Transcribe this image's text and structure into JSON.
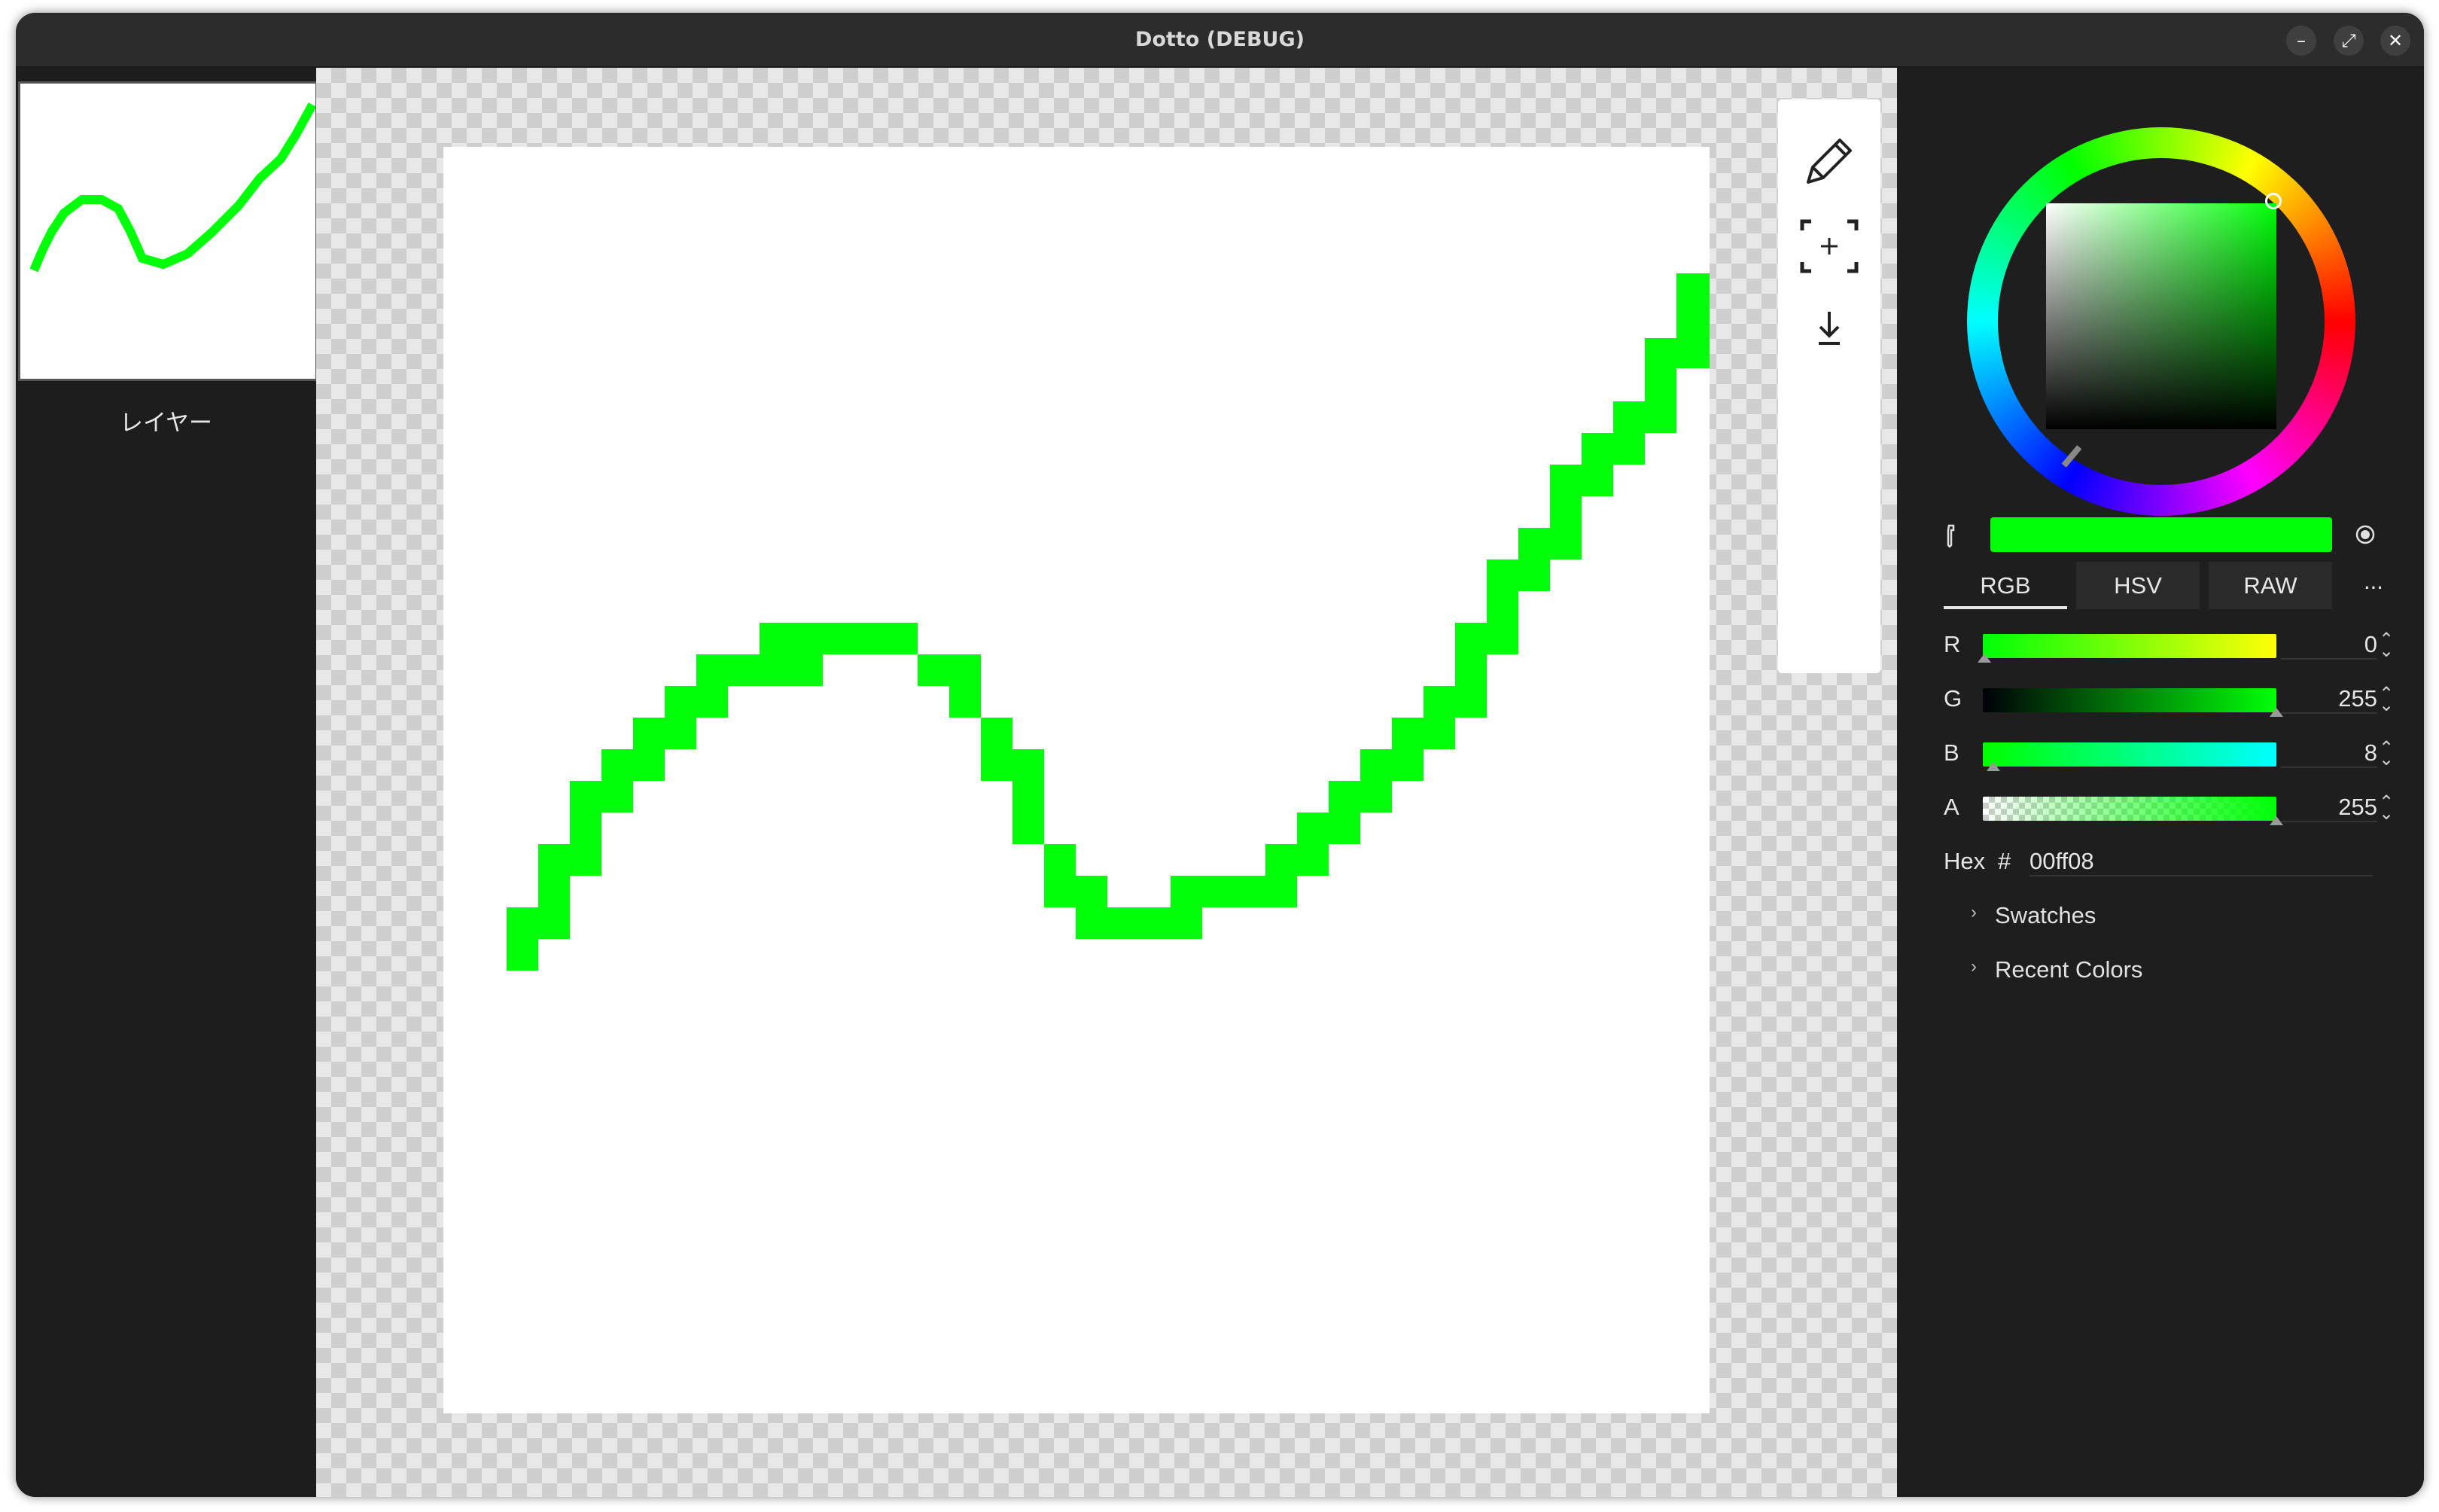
{
  "window": {
    "title": "Dotto (DEBUG)",
    "controls": {
      "minimize": "–",
      "maximize": "⤢",
      "close": "✕"
    }
  },
  "layers": {
    "items": [
      {
        "label": "レイヤー"
      }
    ]
  },
  "tools": [
    {
      "name": "pencil-tool",
      "icon": "pencil-icon"
    },
    {
      "name": "canvas-resize-tool",
      "icon": "crop-icon"
    },
    {
      "name": "export-tool",
      "icon": "download-icon"
    }
  ],
  "color": {
    "current_hex": "#00ff08",
    "tabs": [
      "RGB",
      "HSV",
      "RAW"
    ],
    "active_tab": "RGB",
    "more": "...",
    "channels": [
      {
        "label": "R",
        "value": "0"
      },
      {
        "label": "G",
        "value": "255"
      },
      {
        "label": "B",
        "value": "8"
      },
      {
        "label": "A",
        "value": "255"
      }
    ],
    "hex": {
      "label": "Hex",
      "hash": "#",
      "value": "00ff08"
    },
    "swatches_label": "Swatches",
    "recent_label": "Recent Colors"
  }
}
